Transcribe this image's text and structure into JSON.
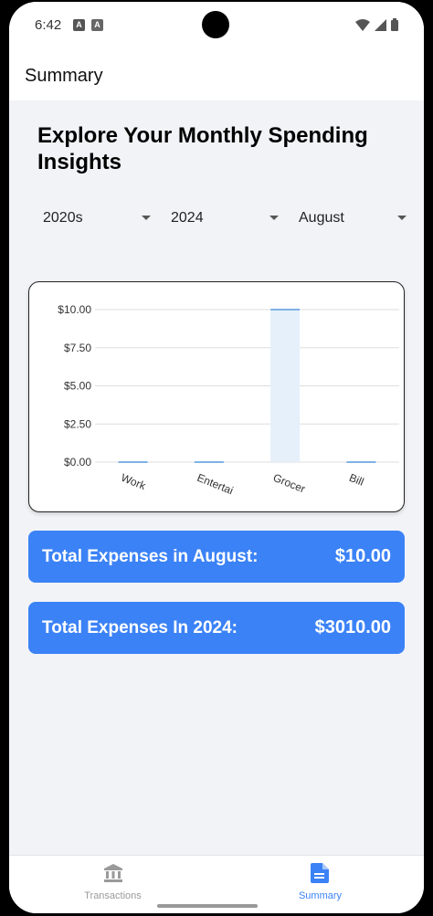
{
  "status_bar": {
    "time": "6:42",
    "notif_icons": [
      "a-icon",
      "a-icon"
    ],
    "system_icons": [
      "wifi-icon",
      "signal-icon",
      "battery-icon"
    ]
  },
  "header": {
    "title": "Summary"
  },
  "page": {
    "heading": "Explore Your Monthly Spending Insights",
    "pickers": {
      "decade": "2020s",
      "year": "2024",
      "month": "August"
    }
  },
  "chart_data": {
    "type": "bar",
    "categories": [
      "Work",
      "Entertai",
      "Grocer",
      "Bill"
    ],
    "values": [
      0,
      0,
      10,
      0
    ],
    "ylim": [
      0,
      10
    ],
    "yticks": [
      "$0.00",
      "$2.50",
      "$5.00",
      "$7.50",
      "$10.00"
    ],
    "ytick_values": [
      0,
      2.5,
      5,
      7.5,
      10
    ],
    "grid": true,
    "bar_fill": "#e6f0fb",
    "bar_stroke": "#7fb2e6"
  },
  "totals": {
    "month_label": "Total Expenses in August:",
    "month_value": "$10.00",
    "year_label": "Total Expenses In 2024:",
    "year_value": "$3010.00"
  },
  "tabs": [
    {
      "label": "Transactions",
      "icon": "bank-icon",
      "active": false
    },
    {
      "label": "Summary",
      "icon": "document-icon",
      "active": true
    }
  ],
  "colors": {
    "accent": "#3b82f6",
    "tab_active": "#3b82f6",
    "tab_inactive": "#9a9a9a"
  }
}
